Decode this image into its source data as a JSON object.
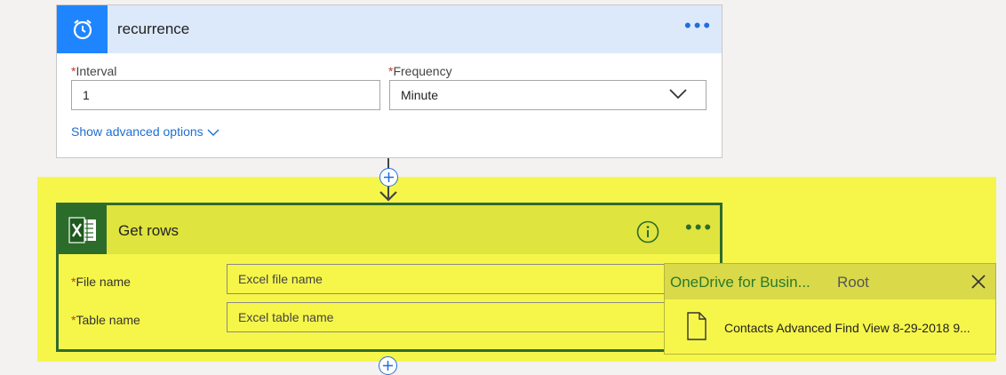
{
  "recurrence": {
    "title": "recurrence",
    "icon": "alarm-clock-icon",
    "more_label": "•••",
    "interval": {
      "required_mark": "*",
      "label": "Interval",
      "value": "1"
    },
    "frequency": {
      "required_mark": "*",
      "label": "Frequency",
      "value": "Minute"
    },
    "show_advanced": "Show advanced options"
  },
  "get_rows": {
    "title": "Get rows",
    "icon": "excel-icon",
    "more_label": "•••",
    "file_name": {
      "required_mark": "*",
      "label": "File name",
      "placeholder": "Excel file name"
    },
    "table_name": {
      "required_mark": "*",
      "label": "Table name",
      "placeholder": "Excel table name"
    }
  },
  "picker": {
    "source": "OneDrive for Busin...",
    "location": "Root",
    "items": [
      {
        "name": "Contacts Advanced Find View 8-29-2018 9...",
        "icon": "file-icon"
      }
    ]
  },
  "colors": {
    "highlight": "#f6f64a",
    "recurrence_accent": "#1f85ff",
    "excel_accent": "#2b6c2b"
  }
}
